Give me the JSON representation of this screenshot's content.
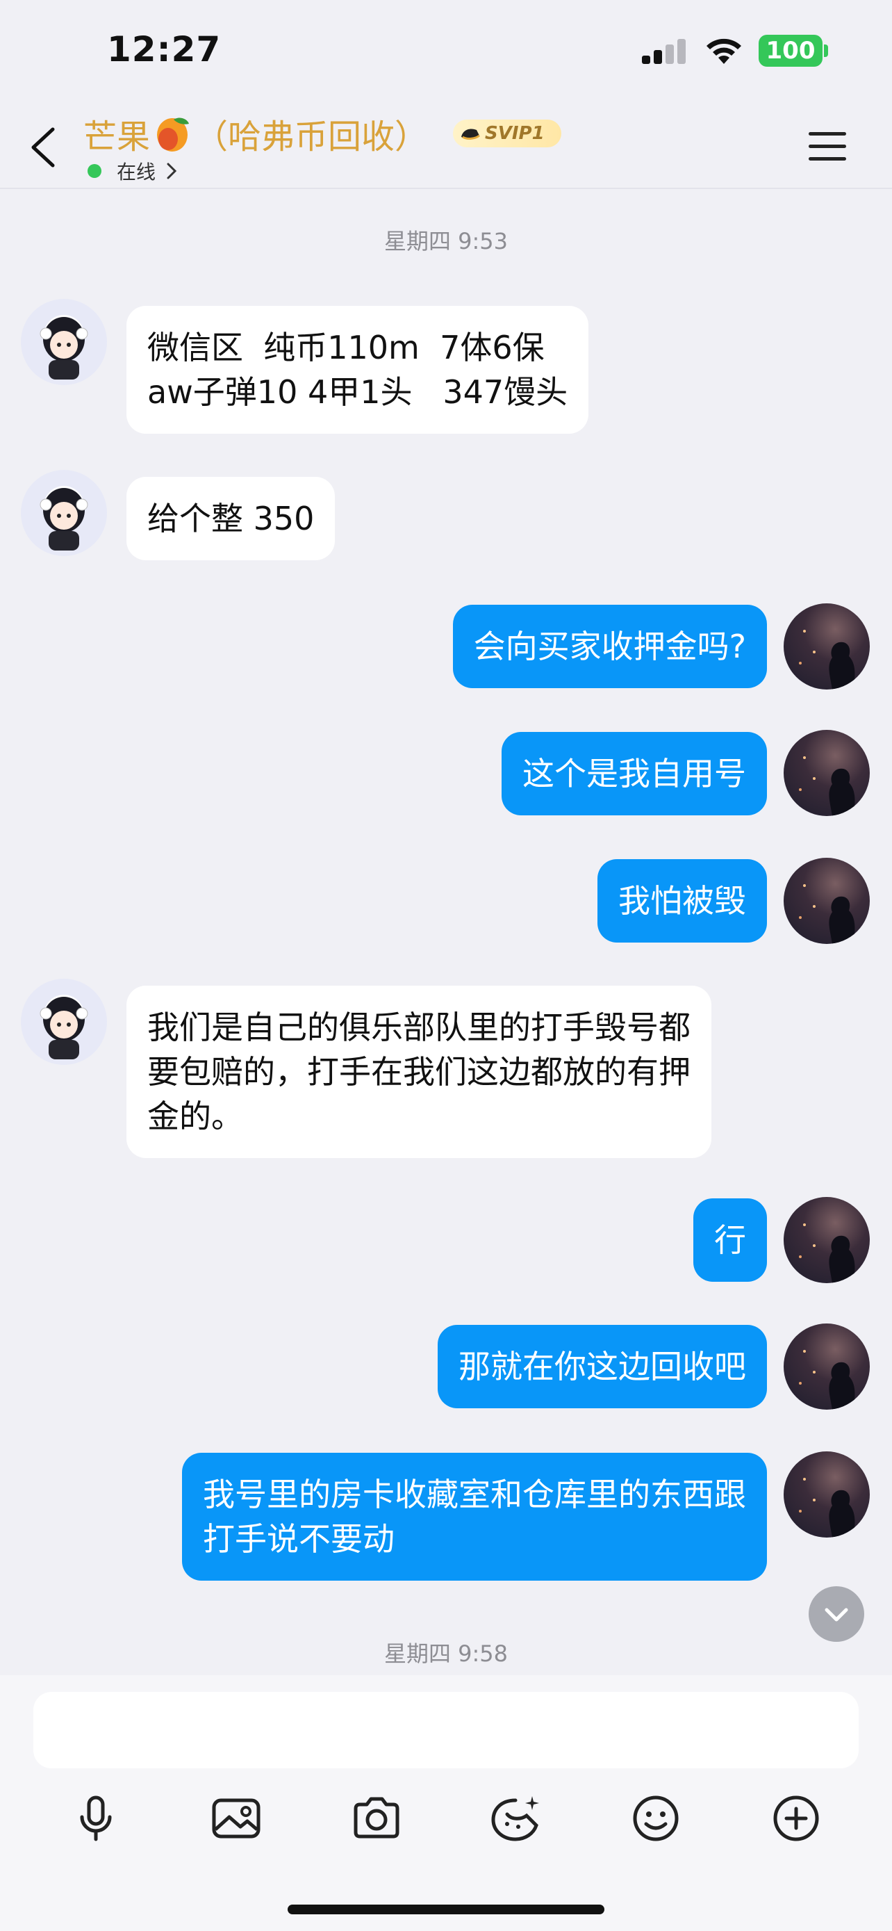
{
  "status_bar": {
    "time": "12:27",
    "battery": "100"
  },
  "header": {
    "title_prefix": "芒果",
    "title_suffix": "（哈弗币回收）",
    "badge": "SVIP1",
    "status": "在线"
  },
  "timestamps": [
    "星期四 9:53",
    "星期四 9:58"
  ],
  "messages": [
    {
      "sender": "other",
      "text": "微信区  纯币110m  7体6保\naw子弹10 4甲1头   347馒头"
    },
    {
      "sender": "other",
      "text": "给个整 350"
    },
    {
      "sender": "self",
      "text": "会向买家收押金吗?"
    },
    {
      "sender": "self",
      "text": "这个是我自用号"
    },
    {
      "sender": "self",
      "text": "我怕被毁"
    },
    {
      "sender": "other",
      "text": "我们是自己的俱乐部队里的打手毁号都\n要包赔的，打手在我们这边都放的有押\n金的。"
    },
    {
      "sender": "self",
      "text": "行"
    },
    {
      "sender": "self",
      "text": "那就在你这边回收吧"
    },
    {
      "sender": "self",
      "text": "我号里的房卡收藏室和仓库里的东西跟\n打手说不要动"
    }
  ],
  "input": {
    "placeholder": ""
  },
  "toolbar": [
    "microphone-icon",
    "image-icon",
    "camera-icon",
    "sticker-icon",
    "emoji-icon",
    "plus-icon"
  ],
  "colors": {
    "accent": "#0996f8",
    "title": "#d9a23a",
    "online": "#35c759",
    "background": "#f0f0f5"
  }
}
